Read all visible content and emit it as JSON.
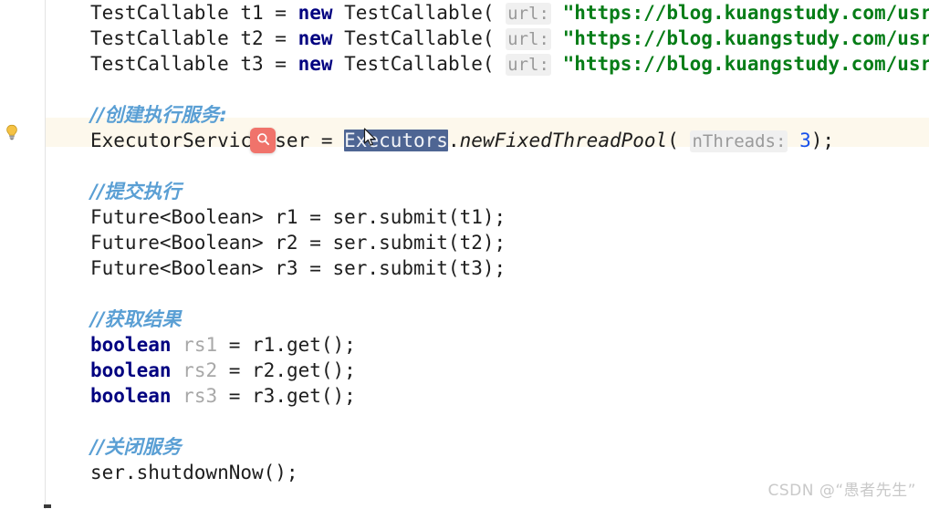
{
  "editor": {
    "gutter": {
      "intention_icon": "lightbulb-icon"
    },
    "find_badge": {
      "icon": "search-icon"
    },
    "cursor": {
      "icon": "mouse-pointer-icon"
    },
    "selection": {
      "text": "Executors",
      "background_color": "#4e6593",
      "text_color": "#f2f4f8"
    },
    "current_line_highlight_color": "#fdf8ec",
    "colors": {
      "keyword": "#000080",
      "string": "#067d17",
      "number": "#1750eb",
      "comment": "#5a9fd4",
      "greyed_identifier": "#a8a8a8",
      "parameter_hint": "#9a9a9a",
      "plain_text": "#1d1d1d",
      "background": "#ffffff"
    },
    "lines": [
      {
        "id": "line-testcallable-t1",
        "segments": [
          {
            "text": "TestCallable t1 = ",
            "style": "plain"
          },
          {
            "text": "new",
            "style": "kw"
          },
          {
            "text": " TestCallable( ",
            "style": "plain"
          },
          {
            "text": "url:",
            "style": "hint"
          },
          {
            "text": " ",
            "style": "plain"
          },
          {
            "text": "\"https://blog.kuangstudy.com/usr",
            "style": "str"
          }
        ]
      },
      {
        "id": "line-testcallable-t2",
        "segments": [
          {
            "text": "TestCallable t2 = ",
            "style": "plain"
          },
          {
            "text": "new",
            "style": "kw"
          },
          {
            "text": " TestCallable( ",
            "style": "plain"
          },
          {
            "text": "url:",
            "style": "hint"
          },
          {
            "text": " ",
            "style": "plain"
          },
          {
            "text": "\"https://blog.kuangstudy.com/usr",
            "style": "str"
          }
        ]
      },
      {
        "id": "line-testcallable-t3",
        "segments": [
          {
            "text": "TestCallable t3 = ",
            "style": "plain"
          },
          {
            "text": "new",
            "style": "kw"
          },
          {
            "text": " TestCallable( ",
            "style": "plain"
          },
          {
            "text": "url:",
            "style": "hint"
          },
          {
            "text": " ",
            "style": "plain"
          },
          {
            "text": "\"https://blog.kuangstudy.com/usr",
            "style": "str"
          }
        ]
      },
      {
        "id": "line-blank-1",
        "segments": []
      },
      {
        "id": "line-comment-create-service",
        "segments": [
          {
            "text": "//创建执行服务:",
            "style": "comment"
          }
        ]
      },
      {
        "id": "line-executorservice",
        "segments": [
          {
            "text": "ExecutorService ser = ",
            "style": "plain"
          },
          {
            "text": "Executors",
            "style": "sel"
          },
          {
            "text": ".",
            "style": "plain"
          },
          {
            "text": "newFixedThreadPool",
            "style": "method"
          },
          {
            "text": "( ",
            "style": "plain"
          },
          {
            "text": "nThreads:",
            "style": "hint"
          },
          {
            "text": " ",
            "style": "plain"
          },
          {
            "text": "3",
            "style": "num"
          },
          {
            "text": ");",
            "style": "plain"
          }
        ]
      },
      {
        "id": "line-blank-2",
        "segments": []
      },
      {
        "id": "line-comment-submit",
        "segments": [
          {
            "text": "//提交执行",
            "style": "comment"
          }
        ]
      },
      {
        "id": "line-future-r1",
        "segments": [
          {
            "text": "Future<Boolean> r1 = ser.submit(t1);",
            "style": "plain"
          }
        ]
      },
      {
        "id": "line-future-r2",
        "segments": [
          {
            "text": "Future<Boolean> r2 = ser.submit(t2);",
            "style": "plain"
          }
        ]
      },
      {
        "id": "line-future-r3",
        "segments": [
          {
            "text": "Future<Boolean> r3 = ser.submit(t3);",
            "style": "plain"
          }
        ]
      },
      {
        "id": "line-blank-3",
        "segments": []
      },
      {
        "id": "line-comment-get-result",
        "segments": [
          {
            "text": "//获取结果",
            "style": "comment"
          }
        ]
      },
      {
        "id": "line-boolean-rs1",
        "segments": [
          {
            "text": "boolean",
            "style": "kw"
          },
          {
            "text": " ",
            "style": "plain"
          },
          {
            "text": "rs1",
            "style": "greyed"
          },
          {
            "text": " = r1.get();",
            "style": "plain"
          }
        ]
      },
      {
        "id": "line-boolean-rs2",
        "segments": [
          {
            "text": "boolean",
            "style": "kw"
          },
          {
            "text": " ",
            "style": "plain"
          },
          {
            "text": "rs2",
            "style": "greyed"
          },
          {
            "text": " = r2.get();",
            "style": "plain"
          }
        ]
      },
      {
        "id": "line-boolean-rs3",
        "segments": [
          {
            "text": "boolean",
            "style": "kw"
          },
          {
            "text": " ",
            "style": "plain"
          },
          {
            "text": "rs3",
            "style": "greyed"
          },
          {
            "text": " = r3.get();",
            "style": "plain"
          }
        ]
      },
      {
        "id": "line-blank-4",
        "segments": []
      },
      {
        "id": "line-comment-shutdown",
        "segments": [
          {
            "text": "//关闭服务",
            "style": "comment"
          }
        ]
      },
      {
        "id": "line-shutdownnow",
        "segments": [
          {
            "text": "ser.shutdownNow();",
            "style": "plain"
          }
        ]
      }
    ]
  },
  "watermark": {
    "text": "CSDN @“愚者先生”"
  }
}
